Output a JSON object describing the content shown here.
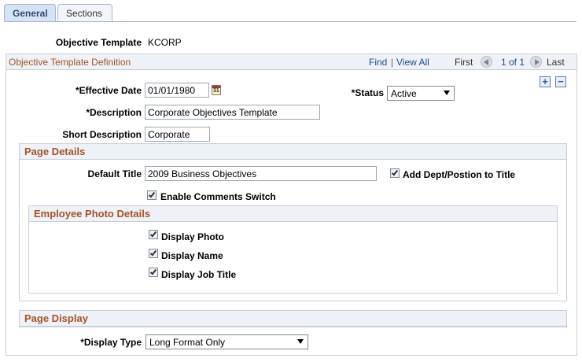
{
  "tabs": [
    {
      "label": "General",
      "active": true
    },
    {
      "label": "Sections",
      "active": false
    }
  ],
  "objective_template": {
    "label": "Objective Template",
    "value": "KCORP"
  },
  "definition": {
    "title": "Objective Template Definition",
    "nav": {
      "find": "Find",
      "separator": "|",
      "view_all": "View All",
      "first": "First",
      "position": "1 of 1",
      "last": "Last"
    },
    "add_row": "+",
    "delete_row": "−",
    "effective_date": {
      "label": "*Effective Date",
      "value": "01/01/1980",
      "calendar_glyph": "31"
    },
    "status": {
      "label": "*Status",
      "value": "Active"
    },
    "description": {
      "label": "*Description",
      "value": "Corporate Objectives Template"
    },
    "short_description": {
      "label": "Short Description",
      "value": "Corporate"
    }
  },
  "page_details": {
    "title": "Page Details",
    "default_title": {
      "label": "Default Title",
      "value": "2009 Business Objectives"
    },
    "add_dept": {
      "label": "Add Dept/Postion to Title",
      "checked": true
    },
    "enable_comments": {
      "label": "Enable Comments Switch",
      "checked": true
    },
    "photo": {
      "title": "Employee Photo Details",
      "display_photo": {
        "label": "Display Photo",
        "checked": true
      },
      "display_name": {
        "label": "Display Name",
        "checked": true
      },
      "display_job_title": {
        "label": "Display Job Title",
        "checked": true
      }
    }
  },
  "page_display": {
    "title": "Page Display",
    "display_type": {
      "label": "*Display Type",
      "value": "Long Format Only"
    }
  },
  "colors": {
    "section_title": "#a4532b",
    "link": "#1c4c8c",
    "tab_active_bg": "#d5e3f4",
    "frame_border": "#c7cfd9"
  },
  "icons": {
    "calendar": "calendar-icon",
    "prev": "previous-icon",
    "next": "next-icon",
    "add": "add-row-icon",
    "delete": "delete-row-icon",
    "dropdown": "chevron-down-icon",
    "check": "checkmark-icon"
  }
}
